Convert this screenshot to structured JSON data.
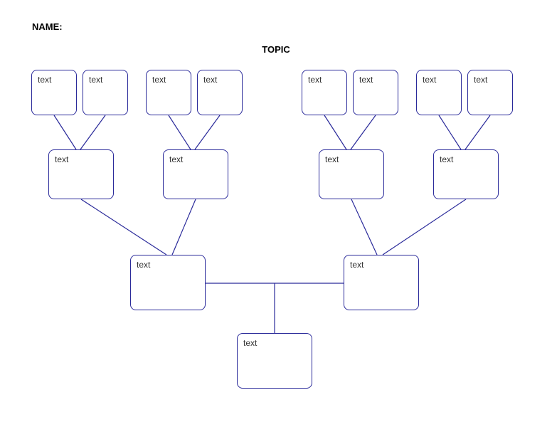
{
  "header": {
    "name_label": "NAME:",
    "topic_label": "TOPIC"
  },
  "row1": [
    {
      "text": "text"
    },
    {
      "text": "text"
    },
    {
      "text": "text"
    },
    {
      "text": "text"
    },
    {
      "text": "text"
    },
    {
      "text": "text"
    },
    {
      "text": "text"
    },
    {
      "text": "text"
    }
  ],
  "row2": [
    {
      "text": "text"
    },
    {
      "text": "text"
    },
    {
      "text": "text"
    },
    {
      "text": "text"
    }
  ],
  "row3": [
    {
      "text": "text"
    },
    {
      "text": "text"
    }
  ],
  "row4": [
    {
      "text": "text"
    }
  ],
  "colors": {
    "border": "#2a2a9a"
  }
}
